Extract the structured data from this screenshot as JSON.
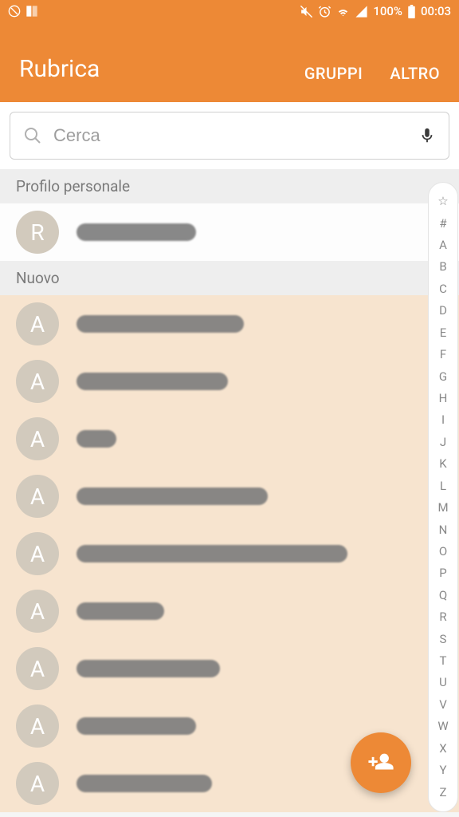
{
  "status": {
    "battery_pct": "100%",
    "time": "00:03"
  },
  "app": {
    "title": "Rubrica",
    "action_groups": "GRUPPI",
    "action_more": "ALTRO"
  },
  "search": {
    "placeholder": "Cerca"
  },
  "sections": {
    "profile_header": "Profilo personale",
    "nuovo_header": "Nuovo"
  },
  "profile": {
    "initial": "R",
    "name_redacted_w": 150
  },
  "contacts": [
    {
      "initial": "A",
      "redact_w": 210
    },
    {
      "initial": "A",
      "redact_w": 190
    },
    {
      "initial": "A",
      "redact_w": 50
    },
    {
      "initial": "A",
      "redact_w": 240
    },
    {
      "initial": "A",
      "redact_w": 340
    },
    {
      "initial": "A",
      "redact_w": 110
    },
    {
      "initial": "A",
      "redact_w": 180
    },
    {
      "initial": "A",
      "redact_w": 150
    },
    {
      "initial": "A",
      "redact_w": 170
    }
  ],
  "alpha_index": [
    "☆",
    "#",
    "A",
    "B",
    "C",
    "D",
    "E",
    "F",
    "G",
    "H",
    "I",
    "J",
    "K",
    "L",
    "M",
    "N",
    "O",
    "P",
    "Q",
    "R",
    "S",
    "T",
    "U",
    "V",
    "W",
    "X",
    "Y",
    "Z"
  ]
}
